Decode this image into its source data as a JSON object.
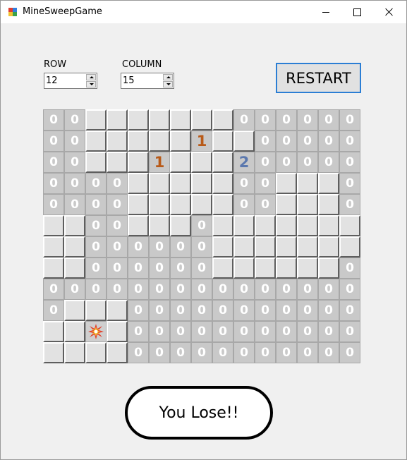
{
  "window": {
    "title": "MineSweepGame",
    "icons": {
      "app": "minesweep-app-icon",
      "minimize": "minimize-icon",
      "maximize": "maximize-icon",
      "close": "close-icon"
    }
  },
  "controls": {
    "row_label": "ROW",
    "row_value": "12",
    "column_label": "COLUMN",
    "column_value": "15",
    "restart_label": "RESTART"
  },
  "board": {
    "rows": 12,
    "columns": 15,
    "legend": {
      "H": "hidden tile",
      "0": "revealed 0",
      "1": "revealed 1",
      "2": "revealed 2",
      "*": "exploded mine"
    },
    "cells": [
      "00H HHHHHH000000",
      "00HHHHH1HH000000",
      "00HHH1HHH2000000",
      "0000HHHHH00HHH0",
      "0000HHHHH00HHH0",
      "HH00HHH0HHHHHHH",
      "HH000000HHHHHHH",
      "HH000000HHHHHH0",
      "000000000000000",
      "0HHH00000000000",
      "HH*H00000000000",
      "HHHH00000000000"
    ],
    "colors": {
      "number_1": "#b85a18",
      "number_2": "#5b78ae",
      "zero": "#ffffff"
    }
  },
  "result": {
    "message": "You Lose!!"
  }
}
